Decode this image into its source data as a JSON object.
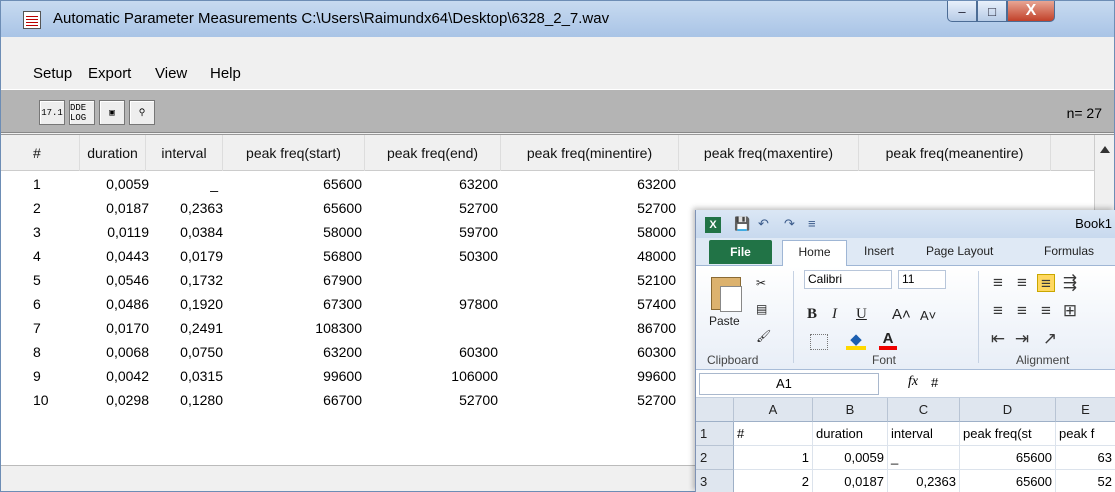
{
  "window": {
    "title": "Automatic Parameter Measurements C:\\Users\\Raimundx64\\Desktop\\6328_2_7.wav",
    "min_symbol": "–",
    "max_symbol": "□",
    "close_symbol": "X"
  },
  "menu": [
    "Setup",
    "Export",
    "View",
    "Help"
  ],
  "toolbar": {
    "buttons": [
      "17.1",
      "DDE LOG",
      "▣",
      "⚲"
    ],
    "count": "n= 27"
  },
  "table": {
    "headers": [
      "#",
      "duration",
      "interval",
      "peak freq(start)",
      "peak freq(end)",
      "peak freq(minentire)",
      "peak freq(maxentire)",
      "peak freq(meanentire)"
    ],
    "rows": [
      [
        "1",
        "0,0059",
        "_",
        "65600",
        "63200",
        "63200"
      ],
      [
        "2",
        "0,0187",
        "0,2363",
        "65600",
        "52700",
        "52700"
      ],
      [
        "3",
        "0,0119",
        "0,0384",
        "58000",
        "59700",
        "58000"
      ],
      [
        "4",
        "0,0443",
        "0,0179",
        "56800",
        "50300",
        "48000"
      ],
      [
        "5",
        "0,0546",
        "0,1732",
        "67900",
        "",
        "52100"
      ],
      [
        "6",
        "0,0486",
        "0,1920",
        "67300",
        "97800",
        "57400"
      ],
      [
        "7",
        "0,0170",
        "0,2491",
        "108300",
        "",
        "86700"
      ],
      [
        "8",
        "0,0068",
        "0,0750",
        "63200",
        "60300",
        "60300"
      ],
      [
        "9",
        "0,0042",
        "0,0315",
        "99600",
        "106000",
        "99600"
      ],
      [
        "10",
        "0,0298",
        "0,1280",
        "66700",
        "52700",
        "52700"
      ]
    ]
  },
  "excel": {
    "book": "Book1",
    "tabs": [
      "File",
      "Home",
      "Insert",
      "Page Layout",
      "Formulas"
    ],
    "clipboard_label": "Clipboard",
    "font_label": "Font",
    "alignment_label": "Alignment",
    "paste_label": "Paste",
    "font_name": "Calibri",
    "font_size": "11",
    "name_box": "A1",
    "formula": "#",
    "columns": [
      "A",
      "B",
      "C",
      "D",
      "E"
    ],
    "header_row": [
      "#",
      "duration",
      "interval",
      "peak freq(st",
      "peak f"
    ],
    "rows": [
      [
        "2",
        "1",
        "0,0059",
        "_",
        "65600",
        "63"
      ],
      [
        "3",
        "2",
        "0,0187",
        "0,2363",
        "65600",
        "52"
      ]
    ],
    "quick_access": [
      "💾",
      "↶",
      "↷",
      "≡"
    ],
    "font_buttons": [
      "B",
      "I",
      "U",
      "A˄",
      "A˅"
    ],
    "misc_icons": [
      "✂",
      "▤",
      "🖌",
      "A"
    ]
  },
  "colors": {
    "title_bar": "#b9d0eb",
    "toolbar_gray": "#b4b4b4",
    "excel_green": "#217346"
  }
}
